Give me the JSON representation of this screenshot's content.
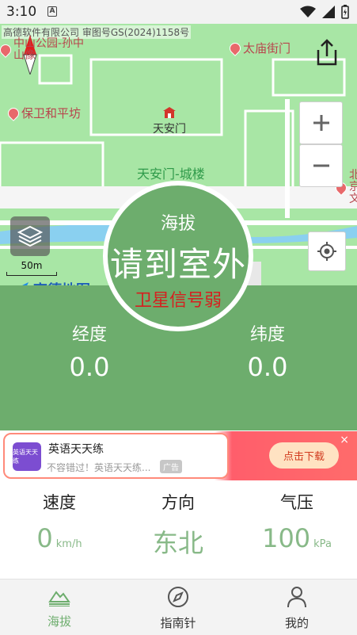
{
  "status_bar": {
    "time": "3:10",
    "notification": "A"
  },
  "map": {
    "attribution": "高德软件有限公司 审图号GS(2024)1158号",
    "pois": [
      "中山公园-孙中山像",
      "太庙街门",
      "保卫和平坊",
      "天安门",
      "天安门-城楼",
      "北京文"
    ],
    "scale_label": "50m",
    "logo_text": "高德地图"
  },
  "gauge": {
    "title": "海拔",
    "value": "请到室外",
    "signal": "卫星信号弱"
  },
  "coordinates": {
    "longitude_label": "经度",
    "longitude_value": "0.0",
    "latitude_label": "纬度",
    "latitude_value": "0.0"
  },
  "ad": {
    "icon_text": "英语天天练",
    "title": "英语天天练",
    "subtitle": "不容错过！英语天天练...",
    "tag": "广告",
    "button": "点击下载",
    "close": "×"
  },
  "stats": [
    {
      "label": "速度",
      "value": "0",
      "unit": "km/h"
    },
    {
      "label": "方向",
      "value": "东北",
      "unit": ""
    },
    {
      "label": "气压",
      "value": "100",
      "unit": "kPa"
    }
  ],
  "nav": [
    {
      "label": "海拔",
      "active": true
    },
    {
      "label": "指南针",
      "active": false
    },
    {
      "label": "我的",
      "active": false
    }
  ],
  "colors": {
    "accent": "#6dad6d",
    "map_green": "#a8e6a5",
    "warning_red": "#d61f1f"
  }
}
